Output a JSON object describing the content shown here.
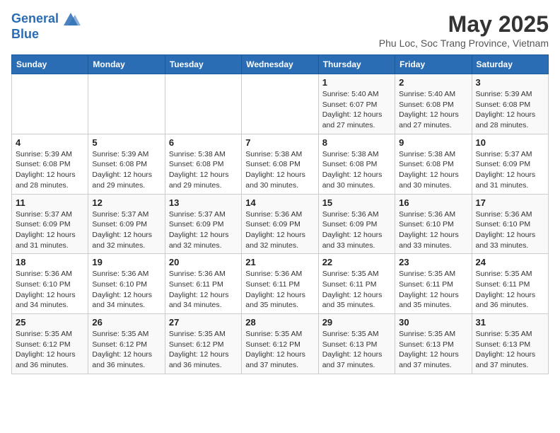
{
  "header": {
    "logo_line1": "General",
    "logo_line2": "Blue",
    "month": "May 2025",
    "location": "Phu Loc, Soc Trang Province, Vietnam"
  },
  "weekdays": [
    "Sunday",
    "Monday",
    "Tuesday",
    "Wednesday",
    "Thursday",
    "Friday",
    "Saturday"
  ],
  "weeks": [
    [
      {
        "day": "",
        "info": ""
      },
      {
        "day": "",
        "info": ""
      },
      {
        "day": "",
        "info": ""
      },
      {
        "day": "",
        "info": ""
      },
      {
        "day": "1",
        "info": "Sunrise: 5:40 AM\nSunset: 6:07 PM\nDaylight: 12 hours and 27 minutes."
      },
      {
        "day": "2",
        "info": "Sunrise: 5:40 AM\nSunset: 6:08 PM\nDaylight: 12 hours and 27 minutes."
      },
      {
        "day": "3",
        "info": "Sunrise: 5:39 AM\nSunset: 6:08 PM\nDaylight: 12 hours and 28 minutes."
      }
    ],
    [
      {
        "day": "4",
        "info": "Sunrise: 5:39 AM\nSunset: 6:08 PM\nDaylight: 12 hours and 28 minutes."
      },
      {
        "day": "5",
        "info": "Sunrise: 5:39 AM\nSunset: 6:08 PM\nDaylight: 12 hours and 29 minutes."
      },
      {
        "day": "6",
        "info": "Sunrise: 5:38 AM\nSunset: 6:08 PM\nDaylight: 12 hours and 29 minutes."
      },
      {
        "day": "7",
        "info": "Sunrise: 5:38 AM\nSunset: 6:08 PM\nDaylight: 12 hours and 30 minutes."
      },
      {
        "day": "8",
        "info": "Sunrise: 5:38 AM\nSunset: 6:08 PM\nDaylight: 12 hours and 30 minutes."
      },
      {
        "day": "9",
        "info": "Sunrise: 5:38 AM\nSunset: 6:08 PM\nDaylight: 12 hours and 30 minutes."
      },
      {
        "day": "10",
        "info": "Sunrise: 5:37 AM\nSunset: 6:09 PM\nDaylight: 12 hours and 31 minutes."
      }
    ],
    [
      {
        "day": "11",
        "info": "Sunrise: 5:37 AM\nSunset: 6:09 PM\nDaylight: 12 hours and 31 minutes."
      },
      {
        "day": "12",
        "info": "Sunrise: 5:37 AM\nSunset: 6:09 PM\nDaylight: 12 hours and 32 minutes."
      },
      {
        "day": "13",
        "info": "Sunrise: 5:37 AM\nSunset: 6:09 PM\nDaylight: 12 hours and 32 minutes."
      },
      {
        "day": "14",
        "info": "Sunrise: 5:36 AM\nSunset: 6:09 PM\nDaylight: 12 hours and 32 minutes."
      },
      {
        "day": "15",
        "info": "Sunrise: 5:36 AM\nSunset: 6:09 PM\nDaylight: 12 hours and 33 minutes."
      },
      {
        "day": "16",
        "info": "Sunrise: 5:36 AM\nSunset: 6:10 PM\nDaylight: 12 hours and 33 minutes."
      },
      {
        "day": "17",
        "info": "Sunrise: 5:36 AM\nSunset: 6:10 PM\nDaylight: 12 hours and 33 minutes."
      }
    ],
    [
      {
        "day": "18",
        "info": "Sunrise: 5:36 AM\nSunset: 6:10 PM\nDaylight: 12 hours and 34 minutes."
      },
      {
        "day": "19",
        "info": "Sunrise: 5:36 AM\nSunset: 6:10 PM\nDaylight: 12 hours and 34 minutes."
      },
      {
        "day": "20",
        "info": "Sunrise: 5:36 AM\nSunset: 6:11 PM\nDaylight: 12 hours and 34 minutes."
      },
      {
        "day": "21",
        "info": "Sunrise: 5:36 AM\nSunset: 6:11 PM\nDaylight: 12 hours and 35 minutes."
      },
      {
        "day": "22",
        "info": "Sunrise: 5:35 AM\nSunset: 6:11 PM\nDaylight: 12 hours and 35 minutes."
      },
      {
        "day": "23",
        "info": "Sunrise: 5:35 AM\nSunset: 6:11 PM\nDaylight: 12 hours and 35 minutes."
      },
      {
        "day": "24",
        "info": "Sunrise: 5:35 AM\nSunset: 6:11 PM\nDaylight: 12 hours and 36 minutes."
      }
    ],
    [
      {
        "day": "25",
        "info": "Sunrise: 5:35 AM\nSunset: 6:12 PM\nDaylight: 12 hours and 36 minutes."
      },
      {
        "day": "26",
        "info": "Sunrise: 5:35 AM\nSunset: 6:12 PM\nDaylight: 12 hours and 36 minutes."
      },
      {
        "day": "27",
        "info": "Sunrise: 5:35 AM\nSunset: 6:12 PM\nDaylight: 12 hours and 36 minutes."
      },
      {
        "day": "28",
        "info": "Sunrise: 5:35 AM\nSunset: 6:12 PM\nDaylight: 12 hours and 37 minutes."
      },
      {
        "day": "29",
        "info": "Sunrise: 5:35 AM\nSunset: 6:13 PM\nDaylight: 12 hours and 37 minutes."
      },
      {
        "day": "30",
        "info": "Sunrise: 5:35 AM\nSunset: 6:13 PM\nDaylight: 12 hours and 37 minutes."
      },
      {
        "day": "31",
        "info": "Sunrise: 5:35 AM\nSunset: 6:13 PM\nDaylight: 12 hours and 37 minutes."
      }
    ]
  ]
}
